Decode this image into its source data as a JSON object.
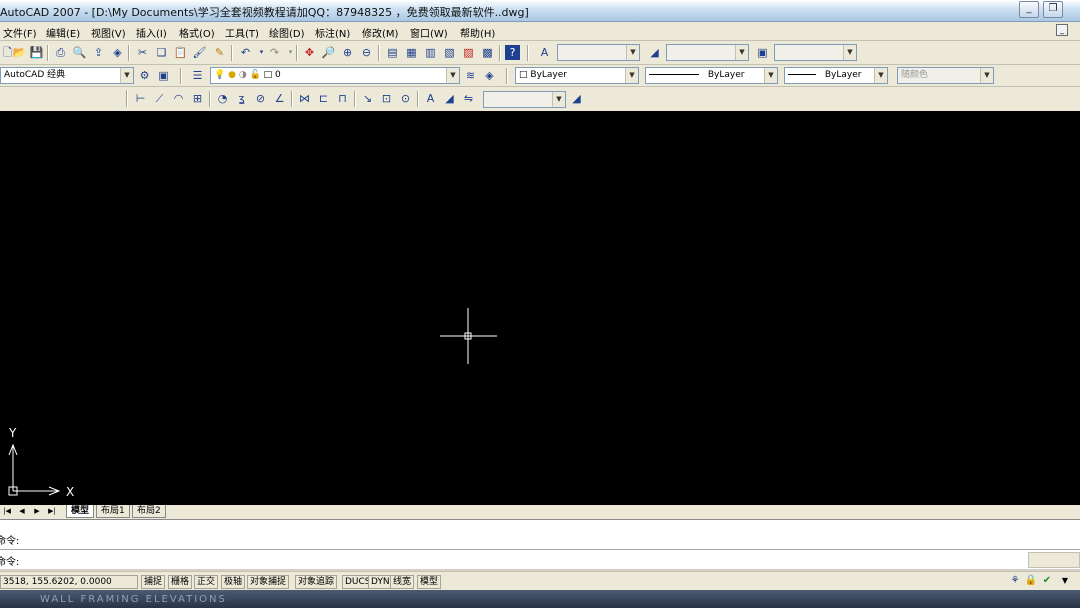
{
  "window": {
    "title": "AutoCAD 2007 - [D:\\My Documents\\学习全套视频教程请加QQ：87948325 ，免费领取最新软件..dwg]",
    "minimize_icon": "minimize-icon",
    "restore_icon": "restore-icon"
  },
  "menu": {
    "items": [
      "文件(F)",
      "编辑(E)",
      "视图(V)",
      "插入(I)",
      "格式(O)",
      "工具(T)",
      "绘图(D)",
      "标注(N)",
      "修改(M)",
      "窗口(W)",
      "帮助(H)"
    ]
  },
  "toolbar_standard": {
    "text_style": "",
    "dim_style": "",
    "table_style": ""
  },
  "toolbar_layers": {
    "workspace": "AutoCAD 经典",
    "layer": "0",
    "color": "ByLayer",
    "linetype": "ByLayer",
    "lineweight": "ByLayer",
    "plotstyle": "随颜色"
  },
  "toolbar_dimension": {
    "dim_style_combo": ""
  },
  "canvas": {
    "background": "#000000",
    "crosshair_color": "#ffffff",
    "ucs_x_label": "X",
    "ucs_y_label": "Y"
  },
  "tabs": {
    "items": [
      "模型",
      "布局1",
      "布局2"
    ],
    "active": "模型"
  },
  "command": {
    "line1": "命令:",
    "line2": "命令:"
  },
  "status": {
    "coordinates": "3518, 155.6202, 0.0000",
    "buttons": [
      "捕捉",
      "栅格",
      "正交",
      "极轴",
      "对象捕捉",
      "对象追踪",
      "DUCS",
      "DYN",
      "线宽",
      "模型"
    ]
  },
  "background_text": "WALL FRAMING ELEVATIONS"
}
